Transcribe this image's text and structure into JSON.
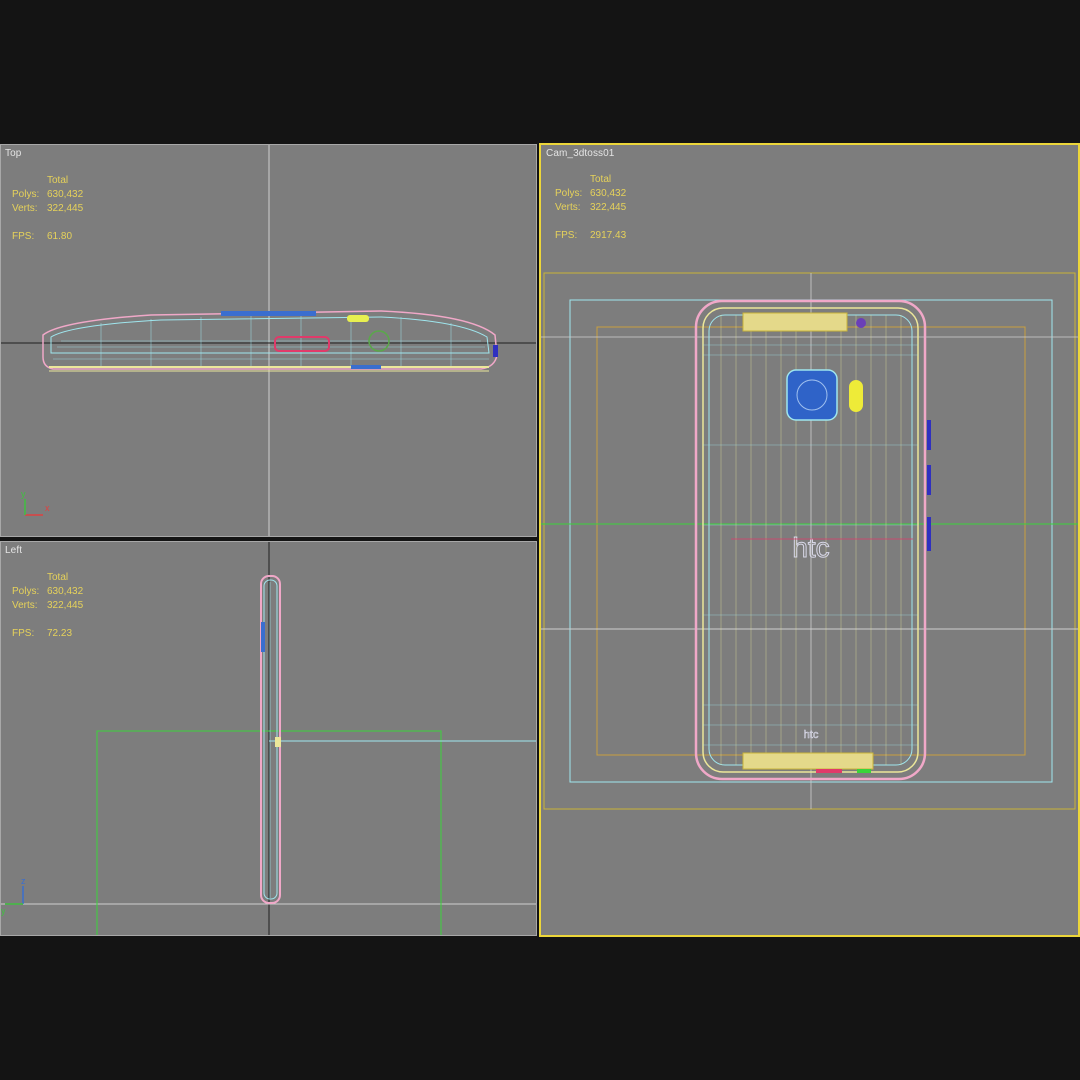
{
  "viewports": {
    "top": {
      "label": "Top",
      "stats": {
        "total_label": "Total",
        "polys_label": "Polys:",
        "polys": "630,432",
        "verts_label": "Verts:",
        "verts": "322,445",
        "fps_label": "FPS:",
        "fps": "61.80"
      }
    },
    "left": {
      "label": "Left",
      "stats": {
        "total_label": "Total",
        "polys_label": "Polys:",
        "polys": "630,432",
        "verts_label": "Verts:",
        "verts": "322,445",
        "fps_label": "FPS:",
        "fps": "72.23"
      }
    },
    "camera": {
      "label": "Cam_3dtoss01",
      "stats": {
        "total_label": "Total",
        "polys_label": "Polys:",
        "polys": "630,432",
        "verts_label": "Verts:",
        "verts": "322,445",
        "fps_label": "FPS:",
        "fps": "2917.43"
      }
    }
  },
  "model": {
    "brand_label": "htc"
  },
  "axis_labels": {
    "x": "x",
    "y": "y",
    "z": "z"
  },
  "colors": {
    "background": "#141414",
    "viewport": "#7d7d7d",
    "active_border": "#ecd63a",
    "stats_text": "#e6d25a",
    "wire_pink": "#f0a8c8",
    "wire_cyan": "#9fe6ee",
    "wire_yellow": "#ece79a",
    "grid_green": "#3ad43a",
    "camera_blue": "#2f63c8"
  }
}
